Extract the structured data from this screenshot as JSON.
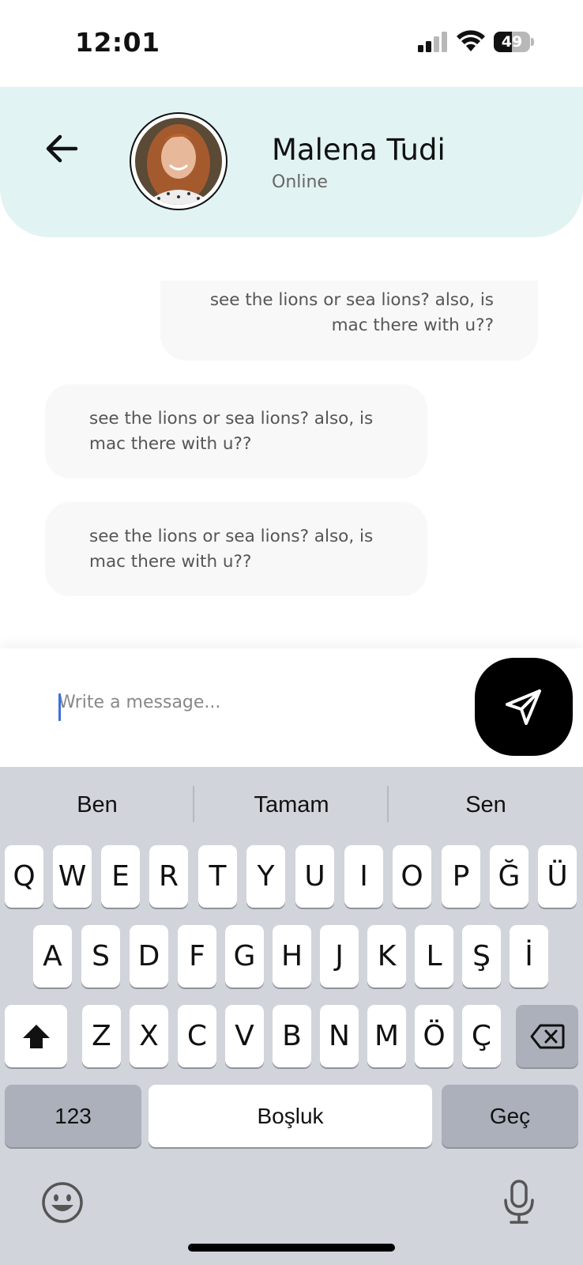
{
  "status_bar": {
    "time": "12:01",
    "battery": "49",
    "battery_level": 0.49
  },
  "header": {
    "back_icon": "arrow-left-icon",
    "contact_name": "Malena Tudi",
    "contact_status": "Online",
    "avatar_alt": "contact avatar"
  },
  "messages": [
    {
      "direction": "outgoing",
      "text": "see the lions or sea lions? also, is mac there with u??"
    },
    {
      "direction": "incoming",
      "text": "see the lions or sea lions? also, is mac there with u??"
    },
    {
      "direction": "incoming",
      "text": "see the lions or sea lions? also, is mac there with u??"
    }
  ],
  "composer": {
    "placeholder": "Write a message...",
    "value": "",
    "send_icon": "send-icon"
  },
  "keyboard": {
    "suggestions": [
      "Ben",
      "Tamam",
      "Sen"
    ],
    "row1": [
      "Q",
      "W",
      "E",
      "R",
      "T",
      "Y",
      "U",
      "I",
      "O",
      "P",
      "Ğ",
      "Ü"
    ],
    "row2": [
      "A",
      "S",
      "D",
      "F",
      "G",
      "H",
      "J",
      "K",
      "L",
      "Ş",
      "İ"
    ],
    "row3": [
      "Z",
      "X",
      "C",
      "V",
      "B",
      "N",
      "M",
      "Ö",
      "Ç"
    ],
    "numbers_label": "123",
    "space_label": "Boşluk",
    "return_label": "Geç",
    "shift_icon": "shift-icon",
    "backspace_icon": "backspace-icon",
    "emoji_icon": "emoji-icon",
    "mic_icon": "microphone-icon"
  },
  "colors": {
    "header_bg": "#e1f3f2",
    "bubble_bg": "#f8f8f8",
    "send_bg": "#000000",
    "caret": "#3b6fe0",
    "keyboard_bg": "#d1d4db"
  }
}
